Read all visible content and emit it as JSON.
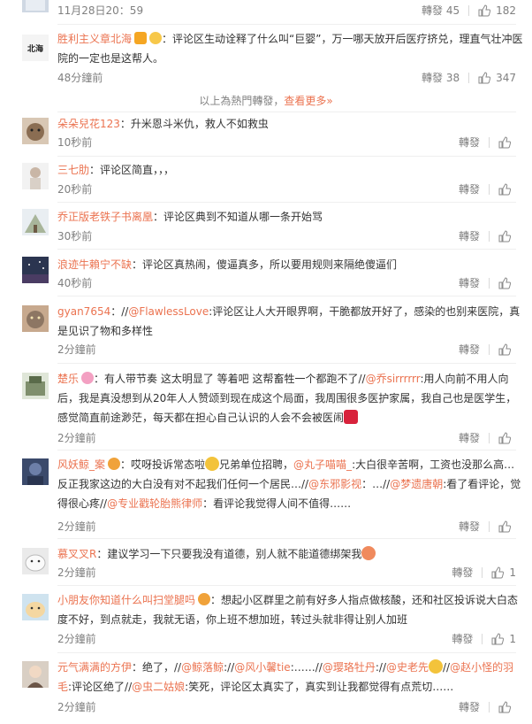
{
  "top_comment": {
    "time": "11月28日20：59",
    "forward": "轉發 45",
    "likes": "182"
  },
  "hot_comment": {
    "user": "胜利主义章北海",
    "text": "：评论区生动诠释了什么叫“巨婴”，万一哪天放开后医疗挤兑，理直气壮冲医院的一定也是这帮人。",
    "time": "48分鐘前",
    "forward": "轉發 38",
    "likes": "347"
  },
  "more_banner": {
    "text": "以上為熱門轉發，",
    "link": "查看更多»"
  },
  "comments": [
    {
      "user": "朵朵兒花123",
      "text": "：升米恩斗米仇，救人不如救虫",
      "time": "10秒前",
      "forward": "轉發",
      "likes": ""
    },
    {
      "user": "三七肋",
      "text": "：评论区简直，，，",
      "time": "20秒前",
      "forward": "轉發",
      "likes": ""
    },
    {
      "user": "乔正版老铁子书离凰",
      "text": "：评论区典到不知道从哪一条开始骂",
      "time": "30秒前",
      "forward": "轉發",
      "likes": ""
    },
    {
      "user": "浪迹牛賴宁不缺",
      "text": "：评论区真热闹，傻逼真多，所以要用规则来隔绝傻逼们",
      "time": "40秒前",
      "forward": "轉發",
      "likes": ""
    },
    {
      "user": "gyan7654",
      "pre": "：//",
      "mention": "@FlawlessLove",
      "text": ":评论区让人大开眼界啊，干脆都放开好了，感染的也别来医院，真是见识了物和多样性",
      "time": "2分鐘前",
      "forward": "轉發",
      "likes": ""
    },
    {
      "user": "楚乐",
      "text1": "：有人带节奏 这太明显了 等着吧 这帮畜牲一个都跑不了//",
      "mention": "@乔sirrrrrr",
      "text2": ":用人向前不用人向后，我是真没想到从20年人人赞颂到现在成这个局面，我周围很多医护家属，我自己也是医学生，感觉简直前途渺茫，每天都在担心自己认识的人会不会被医闹",
      "time": "2分鐘前",
      "forward": "轉發",
      "likes": ""
    },
    {
      "user": "风妖鲸_案",
      "text1": "：哎呀投诉常态啦",
      "text2": "兄弟单位招聘，",
      "m1": "@丸子喵喵_",
      "t3": ":大白很辛苦啊，工资也没那么高…反正我家这边的大白没有对不起我们任何一个居民…//",
      "m2": "@东邪影视",
      "t4": "：…//",
      "m3": "@梦遗唐朝",
      "t5": ":看了看评论，觉得很心疼//",
      "m4": "@专业戳轮胎熊律师",
      "t6": "：看评论我觉得人间不值得……",
      "time": "2分鐘前",
      "forward": "轉發",
      "likes": ""
    },
    {
      "user": "慕叉叉R",
      "text": "：建议学习一下只要我没有道德，别人就不能道德绑架我",
      "time": "2分鐘前",
      "forward": "轉發",
      "likes": "1"
    },
    {
      "user": "小朋友你知道什么叫扫堂腿吗",
      "text": "：想起小区群里之前有好多人指点做核酸，还和社区投诉说大白态度不好，到点就走，我就无语，你上班不想加班，转过头就非得让别人加班",
      "time": "2分鐘前",
      "forward": "轉發",
      "likes": "1"
    },
    {
      "user": "元气满满的方伊",
      "t1": "：绝了，//",
      "m1": "@鲸落鲸",
      "t2": "://",
      "m2": "@风小馨tie",
      "t3": ":……//",
      "m3": "@璎珞牡丹",
      "t4": "://",
      "m4": "@史老先",
      "t5": "//",
      "m5": "@赵小怪的羽毛",
      "t6": ":评论区绝了//",
      "m6": "@虫二姑娘",
      "t7": ":笑死，评论区太真实了，真实到让我都觉得有点荒切……",
      "time": "2分鐘前",
      "forward": "轉發",
      "likes": ""
    }
  ],
  "colors": {
    "accent": "#eb7350",
    "muted": "#808080",
    "text": "#333333"
  }
}
